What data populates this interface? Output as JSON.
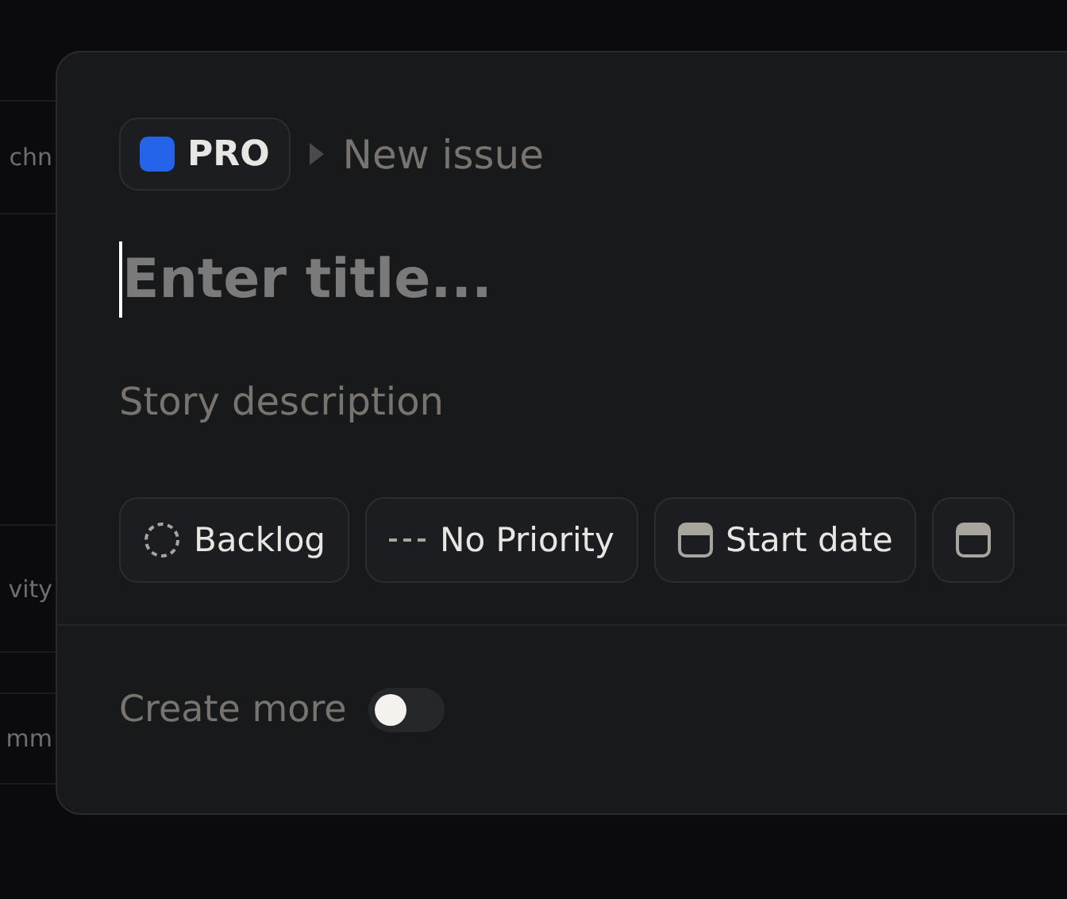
{
  "background_rows": [
    "chn",
    "vity",
    "mm"
  ],
  "modal": {
    "project": {
      "name": "PRO",
      "color": "#2563eb"
    },
    "breadcrumb": "New issue",
    "title": {
      "placeholder": "Enter title..."
    },
    "description": {
      "placeholder": "Story description"
    },
    "properties": [
      {
        "kind": "status",
        "label": "Backlog"
      },
      {
        "kind": "priority",
        "label": "No Priority"
      },
      {
        "kind": "date",
        "label": "Start date"
      },
      {
        "kind": "date"
      }
    ],
    "footer": {
      "label": "Create more",
      "on": false
    }
  }
}
